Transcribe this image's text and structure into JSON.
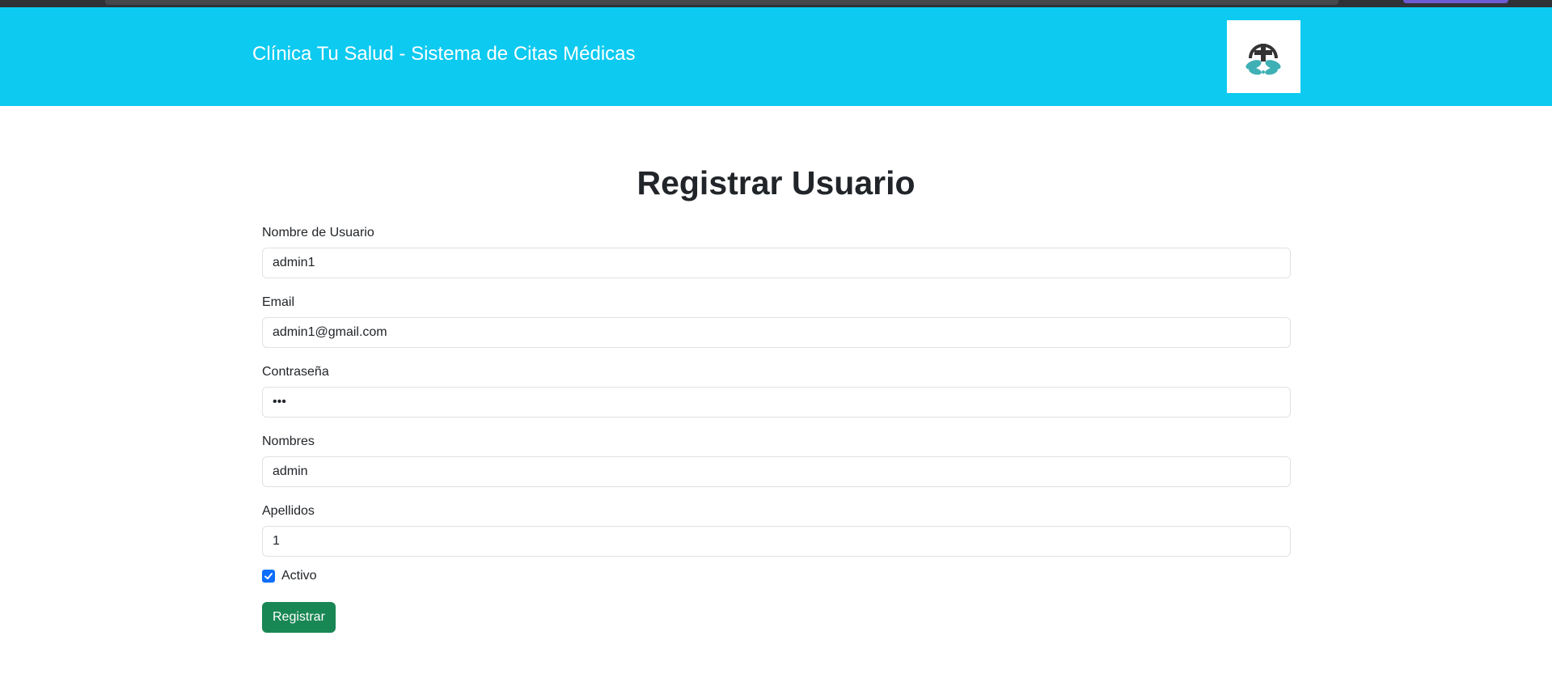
{
  "header": {
    "title": "Clínica Tu Salud - Sistema de Citas Médicas",
    "logo_icon": "medical-cross-leaves-icon"
  },
  "page": {
    "title": "Registrar Usuario"
  },
  "form": {
    "username": {
      "label": "Nombre de Usuario",
      "value": "admin1"
    },
    "email": {
      "label": "Email",
      "value": "admin1@gmail.com"
    },
    "password": {
      "label": "Contraseña",
      "value": "•••"
    },
    "first_names": {
      "label": "Nombres",
      "value": "admin"
    },
    "last_names": {
      "label": "Apellidos",
      "value": "1"
    },
    "active": {
      "label": "Activo",
      "checked": true
    },
    "submit_label": "Registrar"
  },
  "colors": {
    "header_bg": "#0dcaf0",
    "checkbox": "#0d6efd",
    "submit_bg": "#198754"
  }
}
